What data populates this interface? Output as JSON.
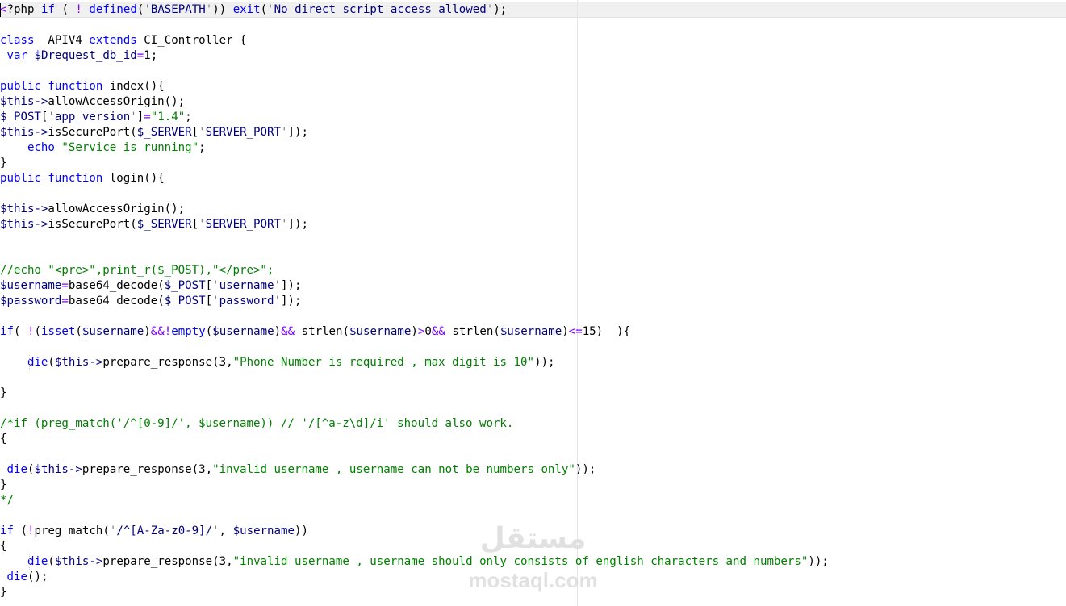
{
  "editor": {
    "language": "PHP",
    "lines": [
      "<?php if ( ! defined('BASEPATH')) exit('No direct script access allowed');",
      "",
      "class  APIV4 extends CI_Controller {",
      " var $Drequest_db_id=1;",
      "",
      "public function index(){",
      "$this->allowAccessOrigin();",
      "$_POST['app_version']=\"1.4\";",
      "$this->isSecurePort($_SERVER['SERVER_PORT']);",
      "    echo \"Service is running\";",
      "}",
      "public function login(){",
      "",
      "$this->allowAccessOrigin();",
      "$this->isSecurePort($_SERVER['SERVER_PORT']);",
      "",
      "",
      "//echo \"<pre>\",print_r($_POST),\"</pre>\";",
      "$username=base64_decode($_POST['username']);",
      "$password=base64_decode($_POST['password']);",
      "",
      "if( !(isset($username)&&!empty($username)&& strlen($username)>0&& strlen($username)<=15)  ){",
      "",
      "    die($this->prepare_response(3,\"Phone Number is required , max digit is 10\"));",
      "",
      "}",
      "",
      "/*if (preg_match('/^[0-9]/', $username)) // '/[^a-z\\d]/i' should also work.",
      "{",
      "",
      " die($this->prepare_response(3,\"invalid username , username can not be numbers only\"));",
      "}",
      "*/",
      "",
      "if (!preg_match('/^[A-Za-z0-9]/', $username))",
      "{",
      "    die($this->prepare_response(3,\"invalid username , username should only consists of english characters and numbers\"));",
      " die();",
      "}"
    ]
  },
  "watermark": {
    "arabic": "مستقل",
    "latin": "mostaql.com"
  },
  "colors": {
    "keyword": "#0000ff",
    "variable": "#000080",
    "string": "#008000",
    "comment": "#008000",
    "operator": "#8000ff",
    "number": "#ff0000",
    "current_line": "#f0f0f0"
  }
}
